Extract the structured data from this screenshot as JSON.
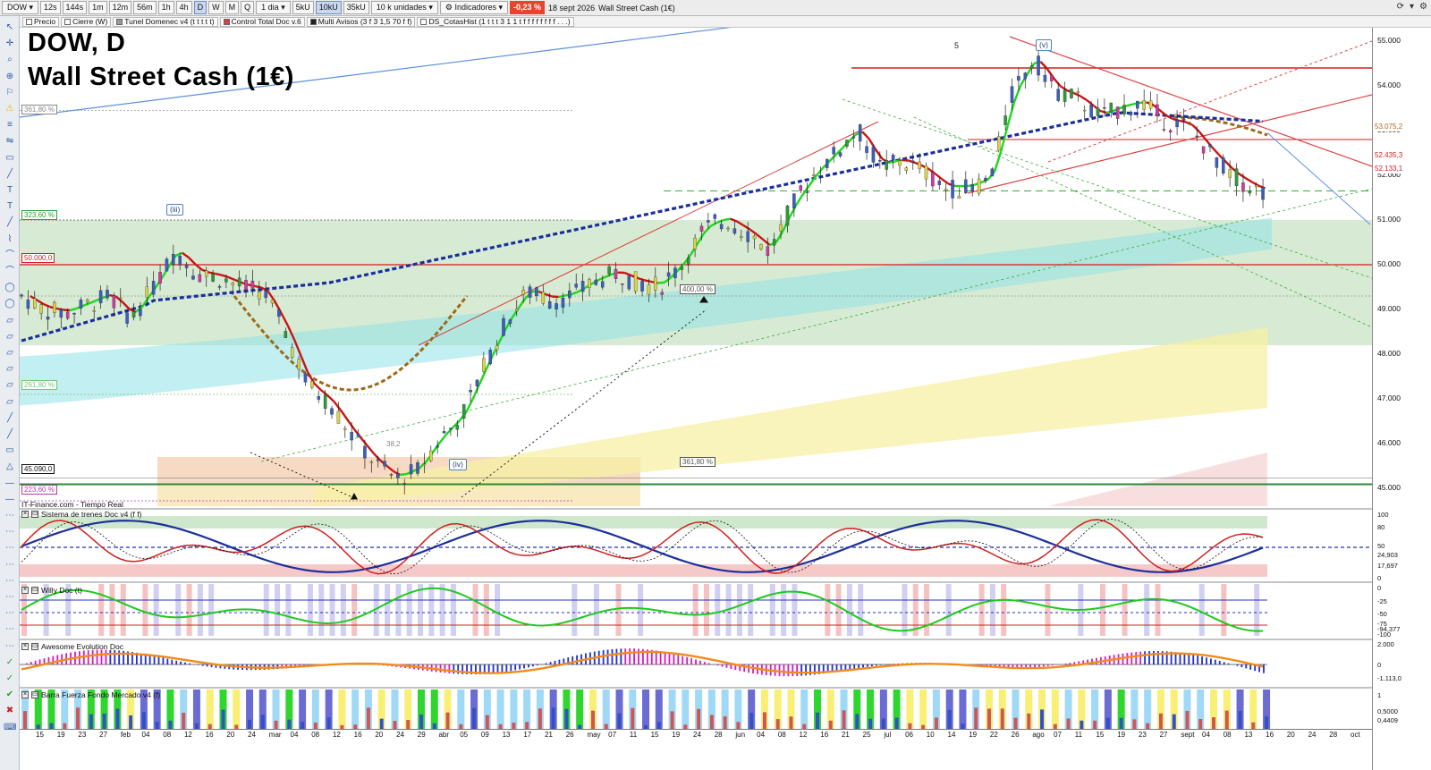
{
  "toolbar": {
    "symbol": "DOW",
    "intervals": [
      "12s",
      "144s",
      "1m",
      "12m",
      "56m",
      "1h",
      "4h",
      "D",
      "W",
      "M",
      "Q"
    ],
    "selected_interval": "D",
    "period": "1 dia",
    "units": [
      "5kU",
      "10kU",
      "35kU"
    ],
    "selected_unit": "10kU",
    "contract_size": "10 k unidades",
    "indicators_label": "Indicadores",
    "change_pct": "-0,23 %",
    "date_text": "18 sept 2026",
    "instrument_text": "Wall Street Cash (1€)"
  },
  "indicator_tabs": [
    {
      "label": "Precio",
      "color": "#ffffff"
    },
    {
      "label": "Cierre (W)",
      "color": "#ffffff"
    },
    {
      "label": "Tunel Domenec v4 (t t t t t)",
      "color": "#9a9a9a"
    },
    {
      "label": "Control Total Doc v.6",
      "color": "#e33c3c"
    },
    {
      "label": "Multi Avisos (3 f 3 1,5 70 f f)",
      "color": "#222222"
    },
    {
      "label": "DS_CotasHist (1 t t t 3 1 1 t f f f f f f f f . . .)",
      "color": "#ffffff"
    }
  ],
  "chart": {
    "title_line1": "DOW, D",
    "title_line2": "Wall Street Cash (1€)",
    "source": "IT-Finance.com - Tiempo Real",
    "top_marker": "5"
  },
  "level_labels": [
    {
      "text": "361,80 %",
      "color": "#888888"
    },
    {
      "text": "323,60 %",
      "color": "#2e9b3b"
    },
    {
      "text": "50.000,0",
      "color": "#d11f1f"
    },
    {
      "text": "261,80 %",
      "color": "#7ac27a"
    },
    {
      "text": "45.090,0",
      "color": "#111111"
    },
    {
      "text": "223,60 %",
      "color": "#b03aa8"
    },
    {
      "text": "400,00 %",
      "color": "#555555"
    },
    {
      "text": "361,80 %",
      "color": "#555555"
    },
    {
      "text": "38,2",
      "color": "#888888"
    }
  ],
  "wave_labels": [
    "(iii)",
    "(iv)",
    "(v)"
  ],
  "price_axis": [
    "55.000",
    "54.000",
    "53.000",
    "52.000",
    "51.000",
    "50.000",
    "49.000",
    "48.000",
    "47.000",
    "46.000",
    "45.000"
  ],
  "price_tags": [
    {
      "text": "53.075,2",
      "bg": "#ffffff",
      "fg": "#b3651d"
    },
    {
      "text": "52.435,3",
      "bg": "#ffffff",
      "fg": "#d11f1f"
    },
    {
      "text": "52.133,1",
      "bg": "#ffffff",
      "fg": "#d11f1f"
    }
  ],
  "panels": [
    {
      "name": "Sistema de trenes Doc v4 (f f)",
      "axis": [
        "100",
        "80",
        "50",
        "24,903",
        "17,697",
        "0"
      ]
    },
    {
      "name": "Willy Doc (t)",
      "axis": [
        "0",
        "-25",
        "-50",
        "-75",
        "-94,377",
        "-100"
      ]
    },
    {
      "name": "Awesome Evolution Doc",
      "axis": [
        "2.000",
        "0",
        "-1.113,0"
      ]
    },
    {
      "name": "Barra Fuerza Fondo Mercado v4 (f)",
      "axis": [
        "1",
        "0,5000",
        "0,4409"
      ]
    }
  ],
  "dates": [
    "15",
    "19",
    "23",
    "27",
    "feb",
    "04",
    "08",
    "12",
    "16",
    "20",
    "24",
    "mar",
    "04",
    "08",
    "12",
    "16",
    "20",
    "24",
    "29",
    "abr",
    "05",
    "09",
    "13",
    "17",
    "21",
    "26",
    "may",
    "07",
    "11",
    "15",
    "19",
    "24",
    "28",
    "jun",
    "04",
    "08",
    "12",
    "16",
    "21",
    "25",
    "jul",
    "06",
    "10",
    "14",
    "19",
    "22",
    "26",
    "ago",
    "07",
    "11",
    "15",
    "19",
    "23",
    "27",
    "sept",
    "04",
    "08",
    "13",
    "16",
    "20",
    "24",
    "28",
    "oct"
  ],
  "chart_data": {
    "type": "candlestick",
    "title": "DOW, D",
    "subtitle": "Wall Street Cash (1€)",
    "ylim": [
      44600,
      55300
    ],
    "close_path": [
      [
        0,
        49300
      ],
      [
        10,
        49000
      ],
      [
        20,
        48900
      ],
      [
        30,
        49100
      ],
      [
        40,
        49300
      ],
      [
        50,
        48800
      ],
      [
        60,
        49500
      ],
      [
        70,
        50300
      ],
      [
        80,
        49800
      ],
      [
        90,
        49700
      ],
      [
        100,
        49500
      ],
      [
        110,
        49400
      ],
      [
        120,
        48500
      ],
      [
        130,
        47300
      ],
      [
        140,
        46900
      ],
      [
        150,
        46200
      ],
      [
        160,
        45600
      ],
      [
        170,
        45200
      ],
      [
        180,
        45400
      ],
      [
        190,
        46100
      ],
      [
        200,
        46600
      ],
      [
        210,
        47700
      ],
      [
        220,
        48700
      ],
      [
        230,
        49400
      ],
      [
        240,
        49200
      ],
      [
        250,
        49300
      ],
      [
        260,
        49600
      ],
      [
        270,
        49800
      ],
      [
        280,
        49600
      ],
      [
        290,
        49500
      ],
      [
        300,
        50000
      ],
      [
        310,
        50800
      ],
      [
        320,
        51000
      ],
      [
        330,
        50700
      ],
      [
        340,
        50300
      ],
      [
        350,
        51300
      ],
      [
        360,
        52000
      ],
      [
        370,
        52500
      ],
      [
        380,
        53000
      ],
      [
        390,
        52200
      ],
      [
        400,
        52300
      ],
      [
        410,
        52100
      ],
      [
        420,
        51700
      ],
      [
        430,
        51700
      ],
      [
        440,
        51900
      ],
      [
        450,
        53800
      ],
      [
        460,
        54600
      ],
      [
        470,
        53900
      ],
      [
        480,
        53700
      ],
      [
        490,
        53300
      ],
      [
        500,
        53500
      ],
      [
        510,
        53600
      ],
      [
        520,
        53200
      ],
      [
        530,
        53100
      ],
      [
        540,
        52500
      ],
      [
        550,
        52000
      ],
      [
        560,
        51700
      ],
      [
        566,
        51600
      ]
    ],
    "levels": [
      50000,
      45090
    ],
    "fib_levels": [
      "361,80 %",
      "323,60 %",
      "261,80 %",
      "223,60 %",
      "400,00 %"
    ]
  }
}
